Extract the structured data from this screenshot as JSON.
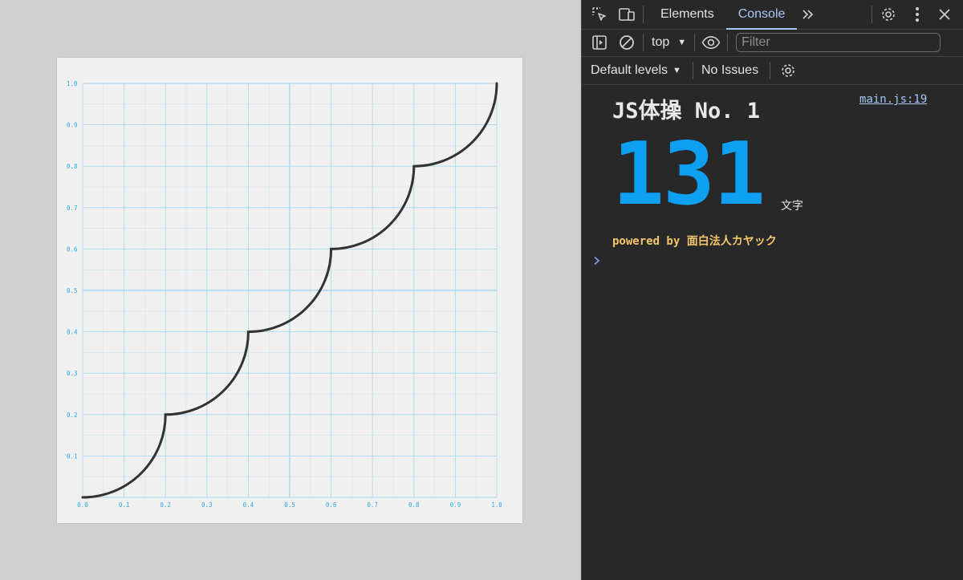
{
  "plot": {
    "x_ticks": [
      "0.0",
      "0.1",
      "0.2",
      "0.3",
      "0.4",
      "0.5",
      "0.6",
      "0.7",
      "0.8",
      "0.9",
      "1.0"
    ],
    "y_ticks": [
      "0.1",
      "0.2",
      "0.3",
      "0.4",
      "0.5",
      "0.6",
      "0.7",
      "0.8",
      "0.9",
      "1.0"
    ],
    "grid_color": "#a8d8f0",
    "tick_color": "#29a8e0",
    "curve_color": "#333333"
  },
  "chart_data": {
    "type": "line",
    "xlim": [
      0,
      1
    ],
    "ylim": [
      0,
      1
    ],
    "grid": true,
    "series": [
      {
        "x": [
          0.0,
          0.05,
          0.1,
          0.15,
          0.2,
          0.2,
          0.25,
          0.3,
          0.35,
          0.4,
          0.4,
          0.45,
          0.5,
          0.55,
          0.6,
          0.6,
          0.65,
          0.7,
          0.75,
          0.8,
          0.8,
          0.85,
          0.9,
          0.95,
          1.0
        ],
        "y": [
          0.0,
          0.0064,
          0.0268,
          0.0677,
          0.2,
          0.2,
          0.2064,
          0.2268,
          0.2677,
          0.4,
          0.4,
          0.4064,
          0.4268,
          0.4677,
          0.6,
          0.6,
          0.6064,
          0.6268,
          0.6677,
          0.8,
          0.8,
          0.8064,
          0.8268,
          0.8677,
          1.0
        ]
      }
    ]
  },
  "devtools": {
    "tabs": {
      "elements": "Elements",
      "console": "Console"
    },
    "context": "top",
    "filter_placeholder": "Filter",
    "default_levels": "Default levels",
    "no_issues": "No Issues"
  },
  "console": {
    "title": "JS体操 No. 1",
    "source": "main.js:19",
    "count": "131",
    "unit": "文字",
    "powered_by": "powered by 面白法人カヤック",
    "accent_color": "#0ea0f0"
  }
}
